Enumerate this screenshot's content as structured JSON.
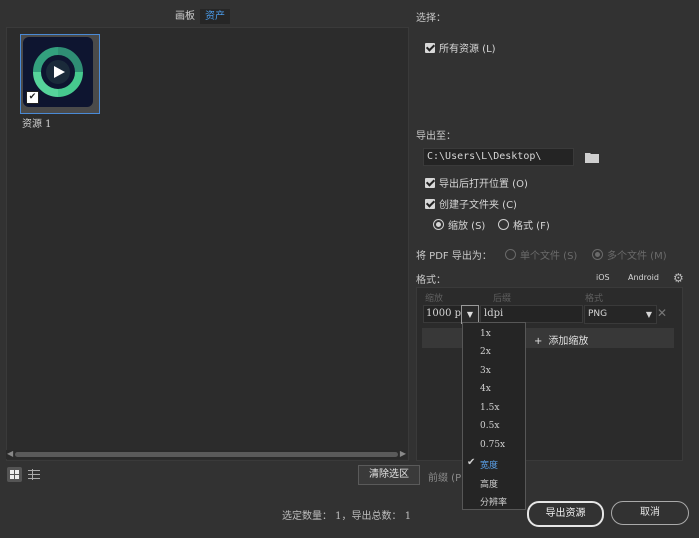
{
  "tabs": {
    "artboard": "画板",
    "assets": "资产"
  },
  "asset": {
    "label": "资源 1"
  },
  "select": {
    "label": "选择：",
    "all_assets": "所有资源 (L)"
  },
  "export_to": {
    "label": "导出至：",
    "path": "C:\\Users\\L\\Desktop\\",
    "open_after": "导出后打开位置 (O)",
    "create_subfolder": "创建子文件夹 (C)",
    "scale_option": "缩放 (S)",
    "format_option": "格式 (F)"
  },
  "pdf": {
    "label": "将 PDF 导出为：",
    "single": "单个文件 (S)",
    "multiple": "多个文件 (M)"
  },
  "formats": {
    "label": "格式：",
    "ios": "iOS",
    "android": "Android",
    "col_scale": "缩放",
    "col_suffix": "后缀",
    "col_format": "格式",
    "scale_value": "1000 p",
    "suffix_value": "ldpi",
    "format_value": "PNG",
    "add_scale": "添加缩放"
  },
  "scale_menu": {
    "items": [
      "1x",
      "2x",
      "3x",
      "4x",
      "1.5x",
      "0.5x",
      "0.75x",
      "宽度",
      "高度",
      "分辨率"
    ],
    "selected": "宽度"
  },
  "bottom": {
    "clear_selection": "清除选区",
    "prefix": "前缀 (P)",
    "status": "选定数量： 1，导出总数： 1",
    "export_button": "导出资源",
    "cancel_button": "取消"
  },
  "icons": {
    "folder": "folder-icon",
    "gear": "gear-icon",
    "grid_view": "grid-view-icon",
    "list_view": "list-view-icon",
    "close": "close-icon",
    "dropdown": "chevron-down-icon"
  },
  "colors": {
    "accent": "#4a9be8",
    "background": "#323232",
    "thumb_bg": "#0e1530",
    "logo_green": "#46c98e"
  }
}
